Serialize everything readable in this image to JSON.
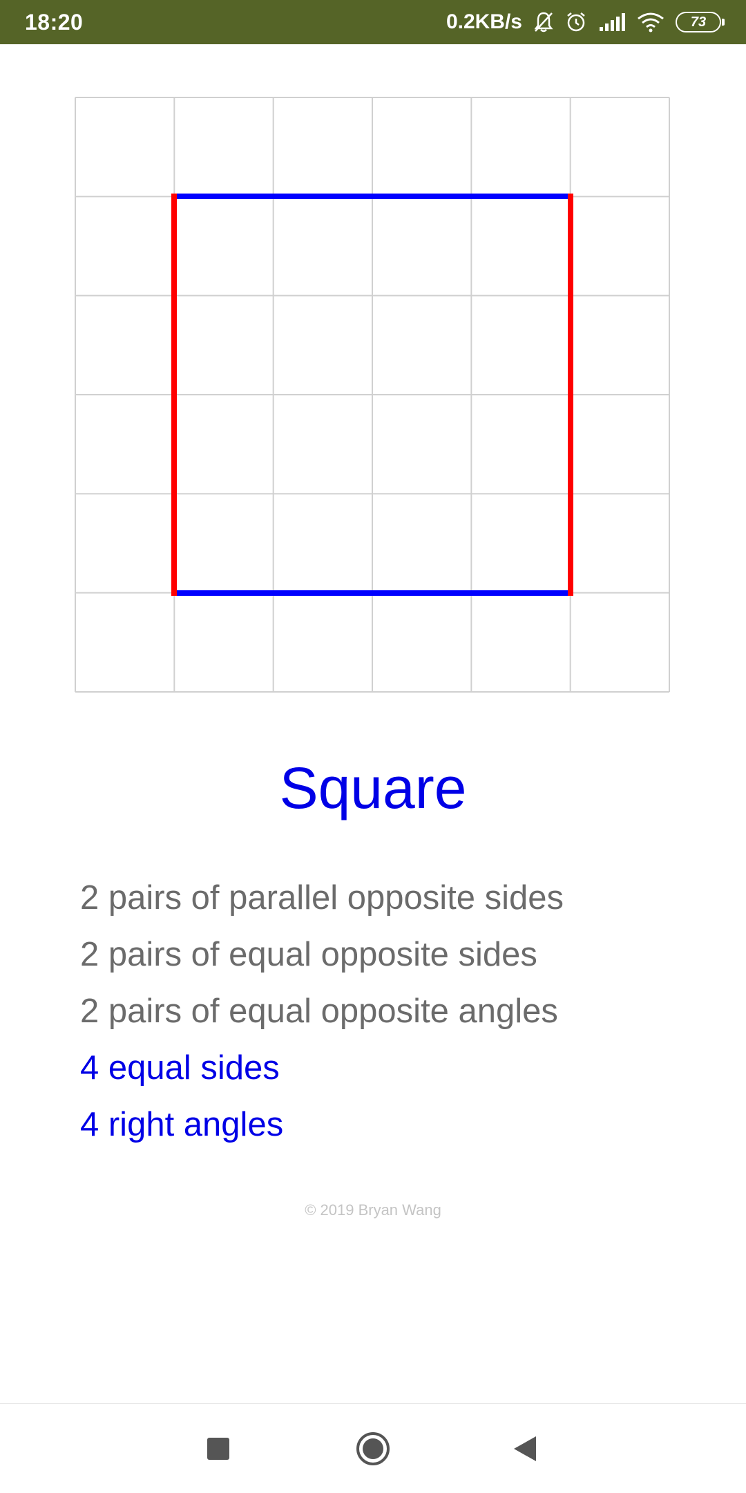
{
  "status_bar": {
    "time": "18:20",
    "network_speed": "0.2KB/s",
    "battery_level": "73",
    "icons": [
      "bell-off-icon",
      "alarm-icon",
      "signal-icon",
      "wifi-icon",
      "battery-icon"
    ],
    "background_color": "#556427"
  },
  "figure": {
    "grid_cells": 6,
    "shape": "square",
    "horizontal_side_color": "#0000ff",
    "vertical_side_color": "#ff0000",
    "grid_color": "#d0d0d0"
  },
  "shape": {
    "title": "Square",
    "title_color": "#0000e6",
    "properties": [
      {
        "text": "2 pairs of parallel opposite sides",
        "highlight": false
      },
      {
        "text": "2 pairs of equal opposite sides",
        "highlight": false
      },
      {
        "text": "2 pairs of equal opposite angles",
        "highlight": false
      },
      {
        "text": "4 equal sides",
        "highlight": true
      },
      {
        "text": "4 right angles",
        "highlight": true
      }
    ]
  },
  "footer": {
    "copyright": "© 2019 Bryan Wang"
  },
  "nav_bar": {
    "buttons": [
      "recents-icon",
      "home-icon",
      "back-icon"
    ]
  }
}
